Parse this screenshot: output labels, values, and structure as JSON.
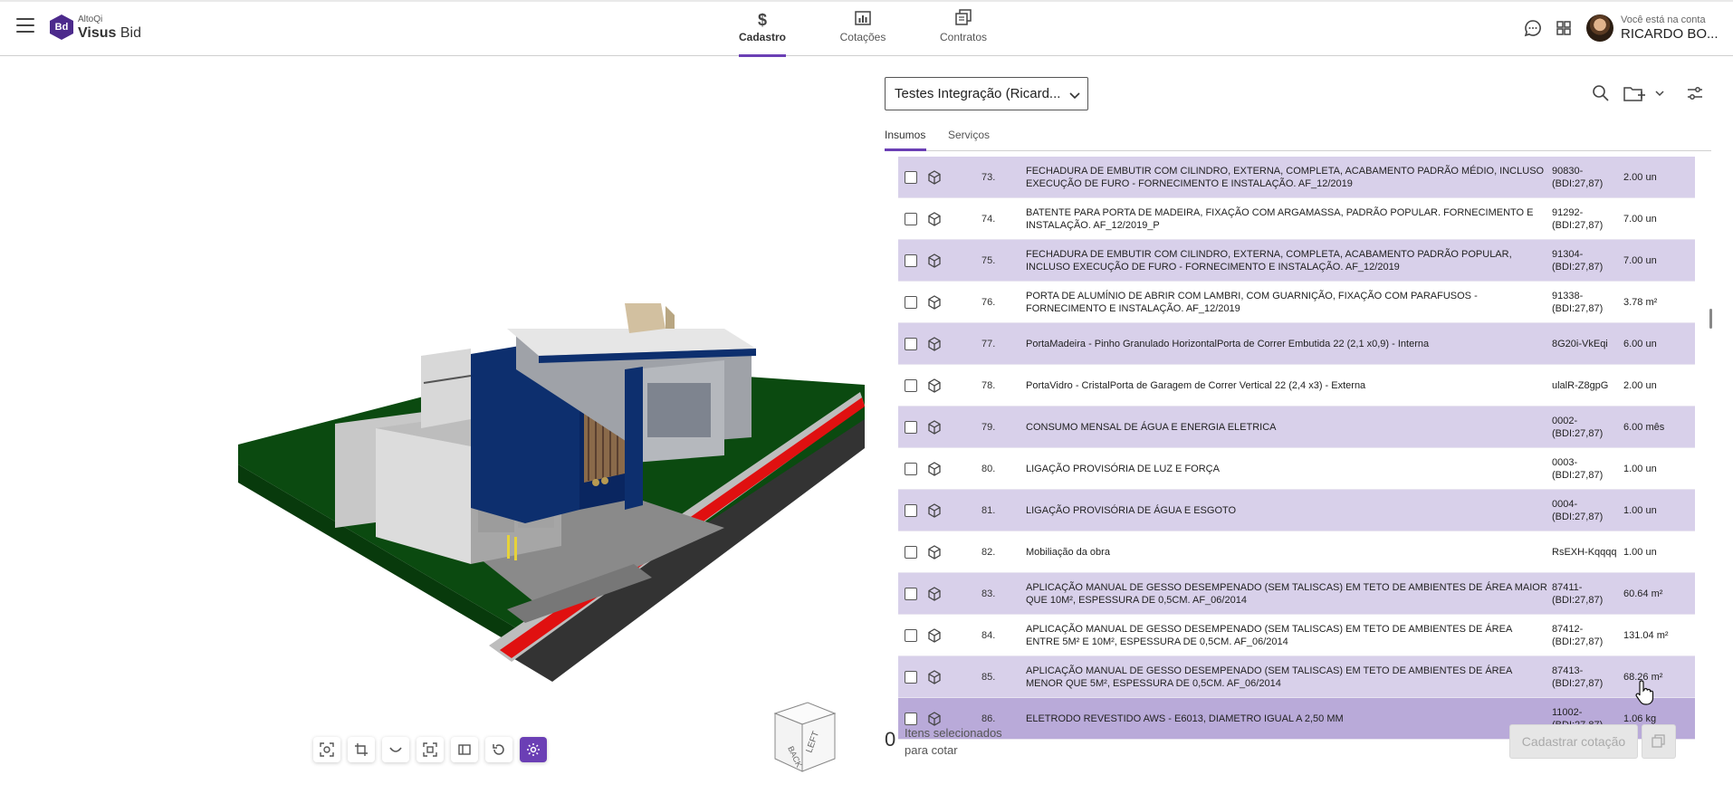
{
  "header": {
    "brand_small": "AltoQi",
    "brand_name_bold": "Visus",
    "brand_name_light": " Bid",
    "logo_text": "Bd",
    "nav": [
      {
        "label": "Cadastro",
        "icon": "$",
        "active": true
      },
      {
        "label": "Cotações",
        "icon": "chart-icon"
      },
      {
        "label": "Contratos",
        "icon": "documents-icon"
      }
    ],
    "account_label": "Você está na conta",
    "account_name": "RICARDO BO..."
  },
  "panel": {
    "project_name": "Testes Integração (Ricard...",
    "tabs": [
      {
        "label": "Insumos",
        "active": true
      },
      {
        "label": "Serviços"
      }
    ],
    "rows": [
      {
        "num": "73.",
        "desc": "FECHADURA DE EMBUTIR COM CILINDRO, EXTERNA, COMPLETA, ACABAMENTO PADRÃO MÉDIO, INCLUSO EXECUÇÃO DE FURO - FORNECIMENTO E INSTALAÇÃO. AF_12/2019",
        "code": "90830-(BDI:27,87)",
        "qty": "2.00 un"
      },
      {
        "num": "74.",
        "desc": "BATENTE PARA PORTA DE MADEIRA, FIXAÇÃO COM ARGAMASSA, PADRÃO POPULAR. FORNECIMENTO E INSTALAÇÃO. AF_12/2019_P",
        "code": "91292-(BDI:27,87)",
        "qty": "7.00 un"
      },
      {
        "num": "75.",
        "desc": "FECHADURA DE EMBUTIR COM CILINDRO, EXTERNA, COMPLETA, ACABAMENTO PADRÃO POPULAR, INCLUSO EXECUÇÃO DE FURO - FORNECIMENTO E INSTALAÇÃO. AF_12/2019",
        "code": "91304-(BDI:27,87)",
        "qty": "7.00 un"
      },
      {
        "num": "76.",
        "desc": "PORTA DE ALUMÍNIO DE ABRIR COM LAMBRI, COM GUARNIÇÃO, FIXAÇÃO COM PARAFUSOS - FORNECIMENTO E INSTALAÇÃO. AF_12/2019",
        "code": "91338-(BDI:27,87)",
        "qty": "3.78 m²"
      },
      {
        "num": "77.",
        "desc": "PortaMadeira - Pinho Granulado HorizontalPorta de Correr Embutida 22 (2,1 x0,9) - Interna",
        "code": "8G20i-VkEqi",
        "qty": "6.00 un"
      },
      {
        "num": "78.",
        "desc": "PortaVidro - CristalPorta de Garagem de Correr Vertical 22 (2,4 x3) - Externa",
        "code": "ulalR-Z8gpG",
        "qty": "2.00 un"
      },
      {
        "num": "79.",
        "desc": "CONSUMO MENSAL DE ÁGUA E ENERGIA ELETRICA",
        "code": "0002-(BDI:27,87)",
        "qty": "6.00 mês"
      },
      {
        "num": "80.",
        "desc": "LIGAÇÃO PROVISÓRIA DE LUZ E FORÇA",
        "code": "0003-(BDI:27,87)",
        "qty": "1.00 un"
      },
      {
        "num": "81.",
        "desc": "LIGAÇÃO PROVISÓRIA DE ÁGUA E ESGOTO",
        "code": "0004-(BDI:27,87)",
        "qty": "1.00 un"
      },
      {
        "num": "82.",
        "desc": "Mobiliação da obra",
        "code": "RsEXH-Kqqqq",
        "qty": "1.00 un"
      },
      {
        "num": "83.",
        "desc": "APLICAÇÃO MANUAL DE GESSO DESEMPENADO (SEM TALISCAS) EM TETO DE AMBIENTES DE ÁREA MAIOR QUE 10M², ESPESSURA DE 0,5CM. AF_06/2014",
        "code": "87411-(BDI:27,87)",
        "qty": "60.64 m²"
      },
      {
        "num": "84.",
        "desc": "APLICAÇÃO MANUAL DE GESSO DESEMPENADO (SEM TALISCAS) EM TETO DE AMBIENTES DE ÁREA ENTRE 5M² E 10M², ESPESSURA DE 0,5CM. AF_06/2014",
        "code": "87412-(BDI:27,87)",
        "qty": "131.04 m²"
      },
      {
        "num": "85.",
        "desc": "APLICAÇÃO MANUAL DE GESSO DESEMPENADO (SEM TALISCAS) EM TETO DE AMBIENTES DE ÁREA MENOR QUE 5M², ESPESSURA DE 0,5CM. AF_06/2014",
        "code": "87413-(BDI:27,87)",
        "qty": "68.26 m²"
      },
      {
        "num": "86.",
        "desc": "ELETRODO REVESTIDO AWS - E6013, DIAMETRO IGUAL A 2,50 MM",
        "code": "11002-(BDI:27,87)",
        "qty": "1.06 kg"
      }
    ],
    "selected_count": "0",
    "selected_label": "Itens selecionados para cotar",
    "register_button": "Cadastrar cotação"
  },
  "viewer": {
    "view_cube_faces": [
      "BACK",
      "LEFT"
    ],
    "toolbar_icons": [
      "focus-icon",
      "crop-icon",
      "curve-icon",
      "fit-view-icon",
      "section-icon",
      "reset-icon",
      "settings-icon"
    ]
  },
  "colors": {
    "accent": "#6b3fb5",
    "row_alt": "#d8d0ea",
    "row_highlight": "#b9aad9"
  }
}
